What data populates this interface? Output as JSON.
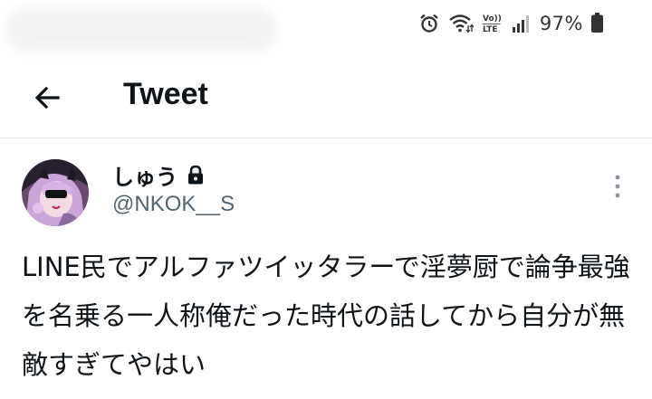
{
  "status_bar": {
    "battery_percent": "97%",
    "network_label": "LTE",
    "icons": [
      "alarm-icon",
      "wifi-icon",
      "volte-icon",
      "signal-icon",
      "battery-icon"
    ]
  },
  "header": {
    "title": "Tweet",
    "back_icon": "arrow-left-icon"
  },
  "tweet": {
    "author": {
      "display_name": "しゅう",
      "handle": "@NKOK__S",
      "protected_icon": "lock-icon",
      "avatar_icon": "avatar"
    },
    "text": "LINE民でアルファツイッタラーで淫夢厨で論争最強を名乗る一人称俺だった時代の話してから自分が無敵すぎてやはい",
    "more_icon": "more-vertical-icon"
  },
  "colors": {
    "text_primary": "#0f1419",
    "text_secondary": "#536471",
    "divider": "#e3e6e8"
  }
}
